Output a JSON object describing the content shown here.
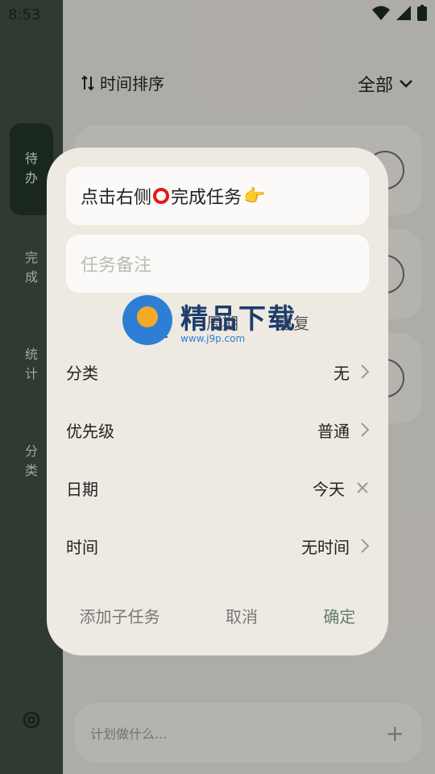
{
  "status": {
    "time": "8:53"
  },
  "header": {
    "sort_label": "时间排序",
    "filter_label": "全部"
  },
  "sidebar": {
    "items": [
      {
        "label": "待\n办"
      },
      {
        "label": "完\n成"
      },
      {
        "label": "统\n计"
      },
      {
        "label": "分\n类"
      }
    ]
  },
  "bottom": {
    "placeholder": "计划做什么..."
  },
  "dialog": {
    "title_text": "点击右侧",
    "title_suffix": "完成任务",
    "note_placeholder": "任务备注",
    "tabs": [
      "普通",
      "周期",
      "重复"
    ],
    "rows": [
      {
        "label": "分类",
        "value": "无",
        "icon": "chevron-right-icon"
      },
      {
        "label": "优先级",
        "value": "普通",
        "icon": "chevron-right-icon"
      },
      {
        "label": "日期",
        "value": "今天",
        "icon": "close-icon"
      },
      {
        "label": "时间",
        "value": "无时间",
        "icon": "chevron-right-icon"
      }
    ],
    "actions": {
      "add_subtask": "添加子任务",
      "cancel": "取消",
      "confirm": "确定"
    }
  },
  "watermark": {
    "cn": "精品下载",
    "url": "www.j9p.com"
  },
  "colors": {
    "sidebar": "#3e4e43",
    "dialog": "#eeeae2",
    "accent": "#5f7f6a"
  }
}
